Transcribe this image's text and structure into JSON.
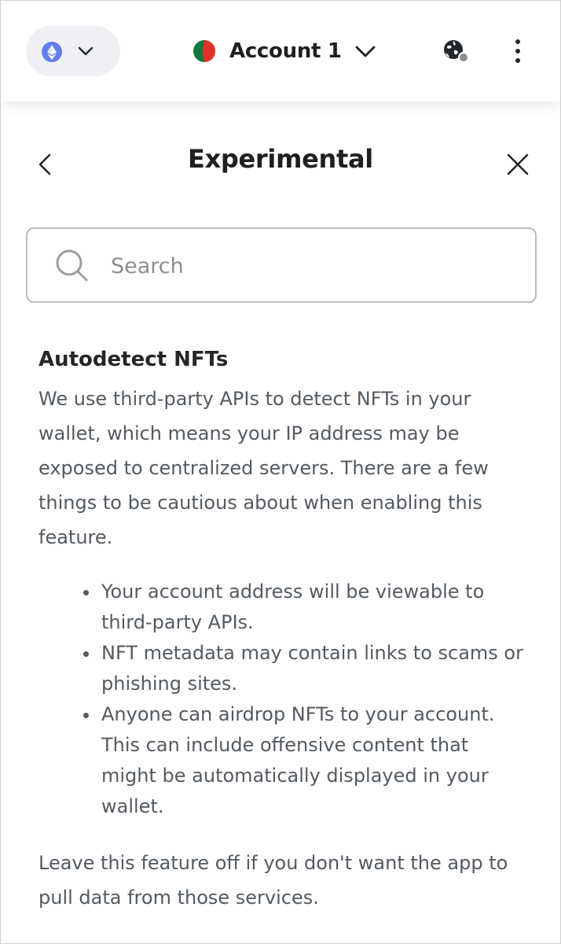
{
  "header": {
    "network_icon": "ethereum-icon",
    "account_name": "Account 1",
    "globe_icon": "globe-icon",
    "menu_icon": "kebab-menu-icon"
  },
  "page": {
    "title": "Experimental",
    "back_icon": "chevron-left-icon",
    "close_icon": "close-icon"
  },
  "search": {
    "placeholder": "Search",
    "value": ""
  },
  "setting": {
    "title": "Autodetect NFTs",
    "description": "We use third-party APIs to detect NFTs in your wallet, which means your IP address may be exposed to centralized servers. There are a few things to be cautious about when enabling this feature.",
    "bullets": [
      "Your account address will be viewable to third-party APIs.",
      "NFT metadata may contain links to scams or phishing sites.",
      "Anyone can airdrop NFTs to your account. This can include offensive content that might be automatically displayed in your wallet."
    ],
    "footer": "Leave this feature off if you don't want the app to pull data from those services."
  },
  "colors": {
    "network_badge": "#627eea",
    "avatar_green": "#0f7a3c",
    "avatar_red": "#e0302a",
    "text_primary": "#24272a",
    "text_secondary": "#535a61"
  }
}
